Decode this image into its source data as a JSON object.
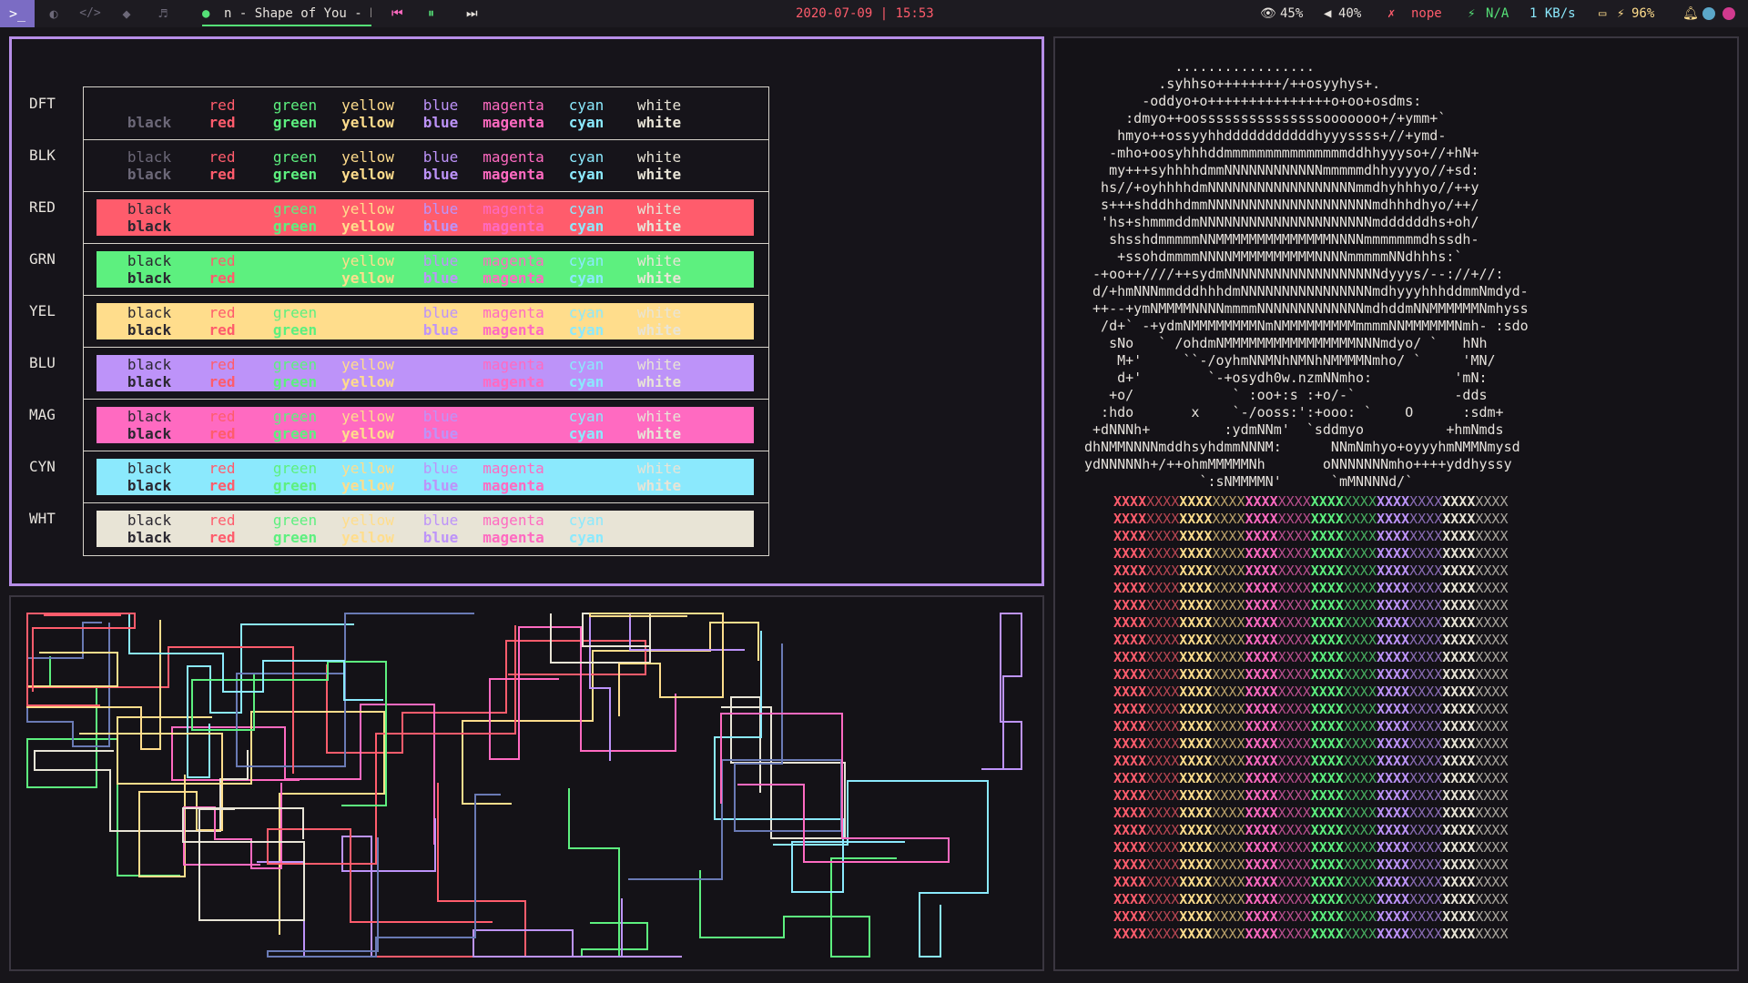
{
  "colors": {
    "accent": "#7b6cc4",
    "border_active": "#b78ee8",
    "red": "#ff5c6c",
    "green": "#5df07f",
    "yellow": "#ffdd8c",
    "blue": "#bd93f9",
    "magenta": "#ff6ac1",
    "cyan": "#8be9fd",
    "white": "#e8e4d6",
    "black": "#1d1b21",
    "gray": "#6c6878",
    "date": "#ff5c6c",
    "music_green": "#55e077"
  },
  "topbar": {
    "workspace_icons": [
      "terminal-icon",
      "firefox-icon",
      "code-icon",
      "telegram-icon",
      "music-icon"
    ],
    "workspace_glyphs": [
      ">_",
      "◐",
      "</>",
      "◆",
      "♬"
    ],
    "track_title": "n - Shape of You - E",
    "prev_glyph": "⏮",
    "pause_glyph": "⏸",
    "next_glyph": "⏭",
    "datetime": "2020-07-09 | 15:53",
    "brightness": "45%",
    "volume": "40%",
    "network": "nope",
    "charging": "N/A",
    "netspeed": "1 KB/s",
    "battery": "96%"
  },
  "colortable": {
    "rows": [
      {
        "label": "DFT",
        "band": null
      },
      {
        "label": "BLK",
        "band": null
      },
      {
        "label": "RED",
        "band": "red"
      },
      {
        "label": "GRN",
        "band": "green"
      },
      {
        "label": "YEL",
        "band": "yellow"
      },
      {
        "label": "BLU",
        "band": "blue"
      },
      {
        "label": "MAG",
        "band": "magenta"
      },
      {
        "label": "CYN",
        "band": "cyan"
      },
      {
        "label": "WHT",
        "band": "white"
      }
    ],
    "columns": [
      "black",
      "red",
      "green",
      "yellow",
      "blue",
      "magenta",
      "cyan",
      "white"
    ]
  },
  "neofetch": {
    "art": "           .................\n         .syhhso++++++++/++osyyhys+.\n       -oddyo+o+++++++++++++++o+oo+osdms:\n     :dmyo++oosssssssssssssssooooooo+/+ymm+`\n    hmyo++ossyyhhdddddddddddhyyyssss+//+ymd-\n   -mho+oosyhhhddmmmmmmmmmmmmmmmddhhyyyso+//+hN+\n   my+++syhhhhdmmNNNNNNNNNNNNmmmmmdhhyyyyo//+sd:\n  hs//+oyhhhhdmNNNNNNNNNNNNNNNNNNmmdhyhhhyo//++y\n  s+++shddhhdmmNNNNNNNNNNNNNNNNNNNNmdhhhdhyo/++/\n  'hs+shmmmddmNNNNNNNNNNNNNNNNNNNNNmddddddhs+oh/\n   shsshdmmmmmNNMMMMMMMMMMMMMMNNNNmmmmmmmdhssdh-\n    +ssohdmmmmNNNNMMMMMMMMMMNNNNmmmmmNNdhhhs:`\n -+oo++////++sydmNNNNNNNNNNNNNNNNNNNdyyys/--://+//:\n d/+hmNNNmmdddhhhdmNNNNNNNNNNNNNNNNmdhyyyhhhddmmNmdyd-\n ++--+ymNMMMMNNNNmmmmNNNNNNNNNNNNNmdhddmNNMMMMMMNmhyss\n  /d+` -+ydmNMMMMMMMMNmNMMMMMMMMMmmmmNNMMMMMMNmh- :sdo\n   sNo   ` /ohdmNMMMMMMMMMMMMMMMMNNNmdyo/ `   hNh\n    M+'     ``-/oyhmNNMNhNMNhNMMMMNmho/ `     'MN/\n    d+'        `-+osydh0w.nzmNNmho:          'mN:\n   +o/            ` :oo+:s :+o/-`            -dds\n  :hdo       x    `-/ooss:':+ooo: `    O      :sdm+\n +dNNNh+         :ydmNNm'  `sddmyo          +hmNmds\ndhNMMNNNNmddhsyhdmmNNNM:      NNmNmhyo+oyyyhmNMMNmysd\nydNNNNNh+/++ohmMMMMMNh       oNNNNNNNmho++++yddhyssy\n              `:sNMMMMN'      `mMNNNNd/`",
    "xgrid_rows": 26
  }
}
